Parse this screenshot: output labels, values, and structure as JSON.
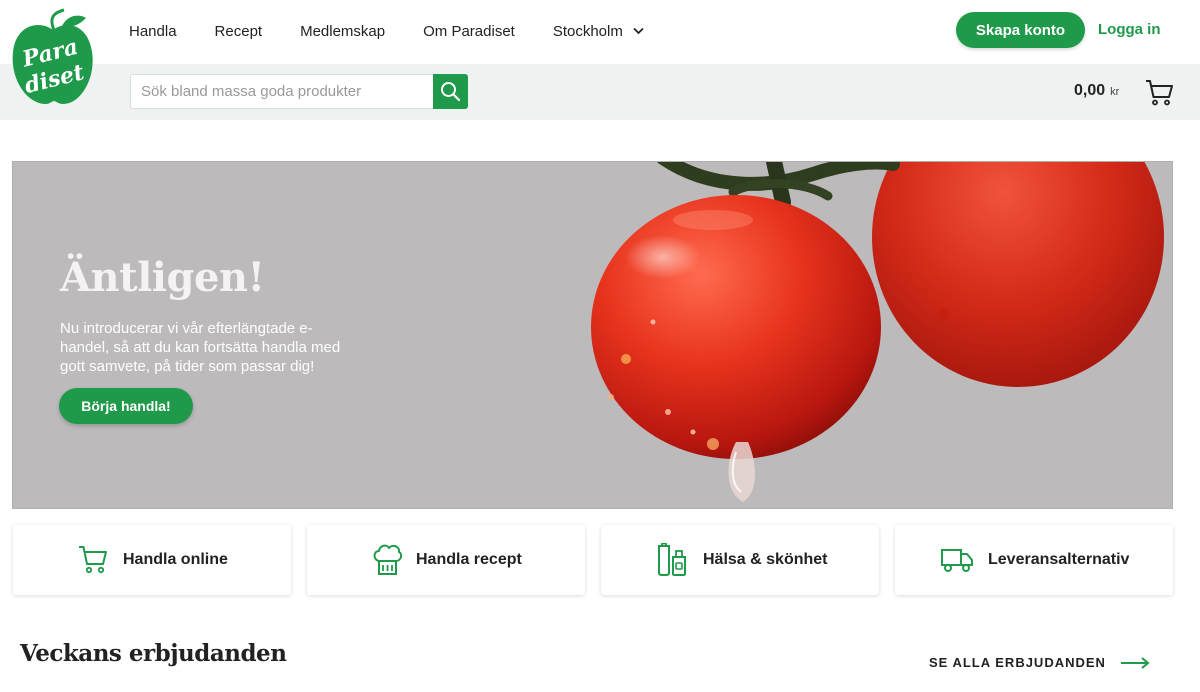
{
  "brand": {
    "logo_text": "Paradiset",
    "color": "#1f9a4a"
  },
  "nav": {
    "items": [
      {
        "label": "Handla"
      },
      {
        "label": "Recept"
      },
      {
        "label": "Medlemskap"
      },
      {
        "label": "Om Paradiset"
      }
    ],
    "location": {
      "label": "Stockholm",
      "icon": "chevron-down-icon"
    }
  },
  "account": {
    "create_label": "Skapa konto",
    "login_label": "Logga in"
  },
  "search": {
    "placeholder": "Sök bland massa goda produkter",
    "value": "",
    "icon": "search-icon"
  },
  "cart": {
    "amount": "0,00",
    "currency": "kr",
    "icon": "cart-icon"
  },
  "hero": {
    "title": "Äntligen!",
    "text": "Nu introducerar vi vår efterlängtade e-handel, så att du kan fortsätta handla med gott samvete, på tider som passar dig!",
    "button_label": "Börja handla!"
  },
  "categories": [
    {
      "label": "Handla online",
      "icon": "cart-icon"
    },
    {
      "label": "Handla recept",
      "icon": "chef-hat-icon"
    },
    {
      "label": "Hälsa & skönhet",
      "icon": "cosmetics-icon"
    },
    {
      "label": "Leveransalternativ",
      "icon": "delivery-truck-icon"
    }
  ],
  "offers": {
    "title": "Veckans erbjudanden",
    "see_all_label": "SE ALLA ERBJUDANDEN",
    "icon": "arrow-right-icon"
  }
}
